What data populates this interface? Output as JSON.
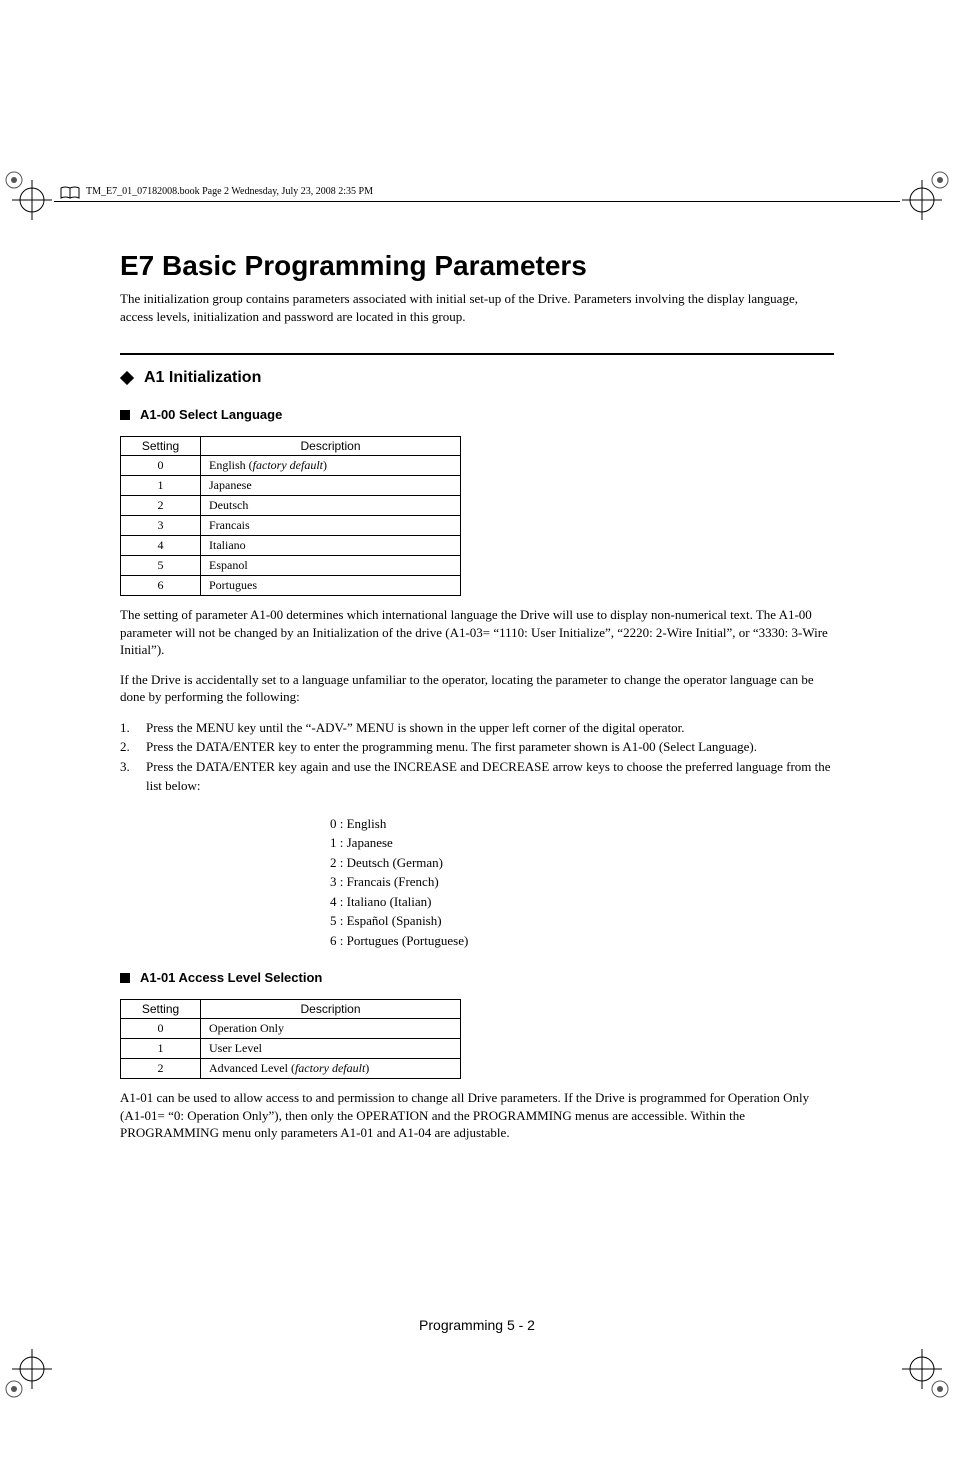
{
  "header": {
    "running_head": "TM_E7_01_07182008.book  Page 2  Wednesday, July 23, 2008  2:35 PM"
  },
  "title": "E7 Basic Programming Parameters",
  "intro": "The initialization group contains parameters associated with initial set-up of the Drive. Parameters involving the display language, access levels, initialization and password are located in this group.",
  "section_a1": {
    "heading": "A1 Initialization",
    "a1_00": {
      "heading": "A1-00  Select Language",
      "table": {
        "headers": {
          "setting": "Setting",
          "description": "Description"
        },
        "rows": [
          {
            "setting": "0",
            "description": "English",
            "factory_default": true
          },
          {
            "setting": "1",
            "description": "Japanese"
          },
          {
            "setting": "2",
            "description": "Deutsch"
          },
          {
            "setting": "3",
            "description": "Francais"
          },
          {
            "setting": "4",
            "description": "Italiano"
          },
          {
            "setting": "5",
            "description": "Espanol"
          },
          {
            "setting": "6",
            "description": "Portugues"
          }
        ]
      },
      "para1": "The setting of parameter A1-00 determines which international language the Drive will use to display non-numerical text. The A1-00 parameter will not be changed by an Initialization of the drive (A1-03= “1110: User Initialize”, “2220: 2-Wire Initial”, or “3330: 3-Wire Initial”).",
      "para2": "If the Drive is accidentally set to a language unfamiliar to the operator, locating the parameter to change the operator language can be done by performing the following:",
      "steps": [
        "Press the MENU key until the “-ADV-” MENU is shown in the upper left corner of the digital operator.",
        "Press the DATA/ENTER key to enter the programming menu. The first parameter shown is A1-00 (Select Language).",
        "Press the DATA/ENTER key again and use the INCREASE and DECREASE arrow keys to choose the preferred language from the list below:"
      ],
      "lang_list": [
        "0 : English",
        "1 : Japanese",
        "2 : Deutsch (German)",
        "3 : Francais (French)",
        "4 : Italiano (Italian)",
        "5 : Español (Spanish)",
        "6 : Portugues (Portuguese)"
      ]
    },
    "a1_01": {
      "heading": "A1-01  Access Level Selection",
      "table": {
        "headers": {
          "setting": "Setting",
          "description": "Description"
        },
        "rows": [
          {
            "setting": "0",
            "description": "Operation Only"
          },
          {
            "setting": "1",
            "description": "User Level"
          },
          {
            "setting": "2",
            "description": "Advanced Level",
            "factory_default": true
          }
        ]
      },
      "para": "A1-01 can be used to allow access to and permission to change all Drive parameters. If the Drive is programmed for Operation Only (A1-01= “0: Operation Only”), then only the OPERATION and the PROGRAMMING menus are accessible. Within the PROGRAMMING menu only parameters A1-01 and A1-04 are adjustable."
    }
  },
  "footer": "Programming  5 - 2",
  "labels": {
    "factory_default": "factory default"
  }
}
